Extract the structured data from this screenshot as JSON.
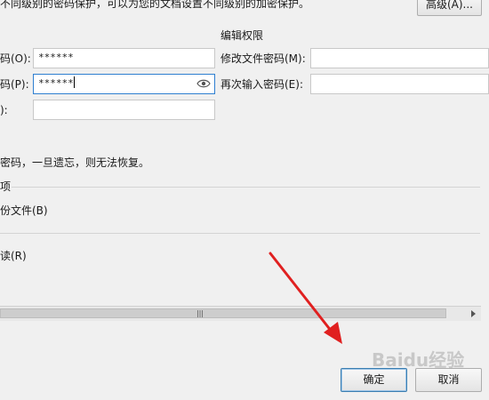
{
  "top": {
    "intro": "不同级别的密码保护，可以为您的文档设置不同级别的加密保护。",
    "advanced_label": "高级(A)..."
  },
  "open_perm": {
    "open_pw_label": "码(O):",
    "open_pw_value": "******",
    "reenter_label": "码(P):",
    "reenter_value": "******",
    "hint_label": "):"
  },
  "edit_perm": {
    "heading": "编辑权限",
    "modify_pw_label": "修改文件密码(M):",
    "reenter_label": "再次输入密码(E):"
  },
  "warning": "密码，一旦遗忘，则无法恢复。",
  "options": {
    "group_label": "项",
    "backup_label": "份文件(B)",
    "readonly_label": "读(R)"
  },
  "footer": {
    "ok_label": "确定",
    "cancel_label": "取消"
  },
  "watermark": "Baidu经验",
  "colors": {
    "arrow": "#e02020",
    "focus_border": "#2f7fd0"
  },
  "icons": [
    "eye-icon",
    "scroll-left-icon",
    "scroll-right-icon",
    "grip-icon"
  ]
}
